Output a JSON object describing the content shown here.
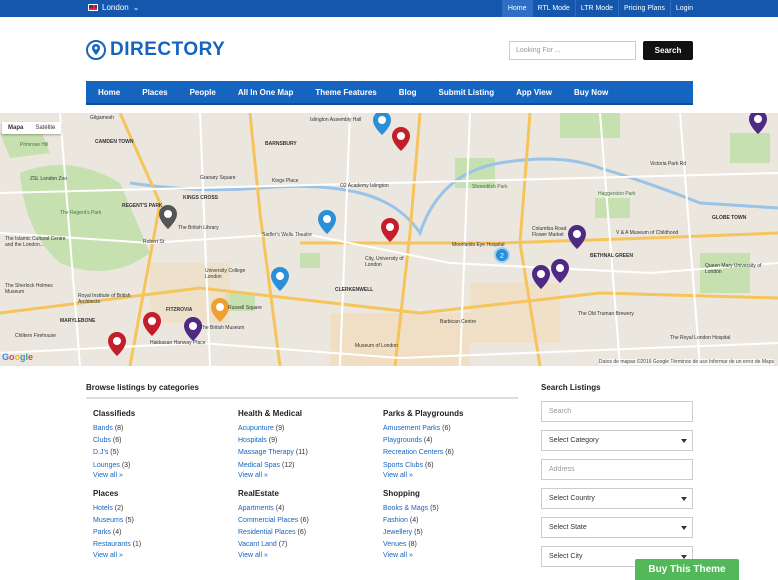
{
  "topbar": {
    "language": "London",
    "links": [
      "Home",
      "RTL Mode",
      "LTR Mode",
      "Pricing Plans",
      "Login"
    ],
    "active_link": "Home"
  },
  "header": {
    "logo_text": "DIRECTORY",
    "search_placeholder": "Looking For ...",
    "search_button": "Search"
  },
  "nav": {
    "items": [
      "Home",
      "Places",
      "People",
      "All In One Map",
      "Theme Features",
      "Blog",
      "Submit Listing",
      "App View",
      "Buy Now"
    ]
  },
  "map": {
    "type_map": "Mapa",
    "type_satellite": "Satélite",
    "google": "Google",
    "attribution": "Datos de mapas ©2016 Google   Términos de uso   Informar de un error de Maps",
    "labels": [
      {
        "text": "Gilgamesh",
        "cls": "l1"
      },
      {
        "text": "CAMDEN TOWN",
        "cls": "l2"
      },
      {
        "text": "Primrose Hill",
        "cls": "l3"
      },
      {
        "text": "ZSL London Zoo",
        "cls": "l4"
      },
      {
        "text": "The Regent's Park",
        "cls": "l5"
      },
      {
        "text": "REGENT'S PARK",
        "cls": "l6"
      },
      {
        "text": "The Islamic Cultural Centre and the London...",
        "cls": "l7"
      },
      {
        "text": "The Sherlock Holmes Museum",
        "cls": "l8"
      },
      {
        "text": "MARYLEBONE",
        "cls": "l9"
      },
      {
        "text": "Chiltern Firehouse",
        "cls": "l10"
      },
      {
        "text": "FITZROVIA",
        "cls": "l11"
      },
      {
        "text": "Royal Institute of British Architects",
        "cls": "l12"
      },
      {
        "text": "The British Library",
        "cls": "l13"
      },
      {
        "text": "KINGS CROSS",
        "cls": "l14"
      },
      {
        "text": "Granary Square",
        "cls": "l15"
      },
      {
        "text": "BARNSBURY",
        "cls": "l16"
      },
      {
        "text": "Kings Place",
        "cls": "l17"
      },
      {
        "text": "Islington Assembly Hall",
        "cls": "l18"
      },
      {
        "text": "O2 Academy Islington",
        "cls": "l19"
      },
      {
        "text": "Sadler's Wells Theatre",
        "cls": "l20"
      },
      {
        "text": "University College London",
        "cls": "l21"
      },
      {
        "text": "Russell Square",
        "cls": "l22"
      },
      {
        "text": "The British Museum",
        "cls": "l23"
      },
      {
        "text": "Hakkasan Hanway Place",
        "cls": "l24"
      },
      {
        "text": "CLERKENWELL",
        "cls": "l25"
      },
      {
        "text": "City, University of London",
        "cls": "l26"
      },
      {
        "text": "Moorfields Eye Hospital",
        "cls": "l27"
      },
      {
        "text": "Barbican Centre",
        "cls": "l28"
      },
      {
        "text": "Museum of London",
        "cls": "l29"
      },
      {
        "text": "Shoreditch Park",
        "cls": "l30"
      },
      {
        "text": "Haggerston Park",
        "cls": "l31"
      },
      {
        "text": "Columbia Road Flower Market",
        "cls": "l32"
      },
      {
        "text": "V & A Museum of Childhood",
        "cls": "l33"
      },
      {
        "text": "BETHNAL GREEN",
        "cls": "l34"
      },
      {
        "text": "GLOBE TOWN",
        "cls": "l35"
      },
      {
        "text": "The Old Truman Brewery",
        "cls": "l36"
      },
      {
        "text": "The Royal London Hospital",
        "cls": "l37"
      },
      {
        "text": "Victoria Park Rd",
        "cls": "l38"
      },
      {
        "text": "Queen Mary University of London",
        "cls": "l39"
      },
      {
        "text": "Robert St",
        "cls": "l40"
      }
    ]
  },
  "categories": {
    "title": "Browse listings by categories",
    "groups": [
      {
        "name": "Classifieds",
        "items": [
          {
            "label": "Bands",
            "count": "(8)"
          },
          {
            "label": "Clubs",
            "count": "(6)"
          },
          {
            "label": "D.J's",
            "count": "(5)"
          },
          {
            "label": "Lounges",
            "count": "(3)"
          }
        ],
        "view_all": "View all »"
      },
      {
        "name": "Health & Medical",
        "items": [
          {
            "label": "Acupunture",
            "count": "(9)"
          },
          {
            "label": "Hospitals",
            "count": "(9)"
          },
          {
            "label": "Massage Therapy",
            "count": "(11)"
          },
          {
            "label": "Medical Spas",
            "count": "(12)"
          }
        ],
        "view_all": "View all »"
      },
      {
        "name": "Parks & Playgrounds",
        "items": [
          {
            "label": "Amusement Parks",
            "count": "(6)"
          },
          {
            "label": "Playgrounds",
            "count": "(4)"
          },
          {
            "label": "Recreation Centers",
            "count": "(6)"
          },
          {
            "label": "Sports Clubs",
            "count": "(6)"
          }
        ],
        "view_all": "View all »"
      },
      {
        "name": "Places",
        "items": [
          {
            "label": "Hotels",
            "count": "(2)"
          },
          {
            "label": "Museums",
            "count": "(5)"
          },
          {
            "label": "Parks",
            "count": "(4)"
          },
          {
            "label": "Restaurants",
            "count": "(1)"
          }
        ],
        "view_all": "View all »"
      },
      {
        "name": "RealEstate",
        "items": [
          {
            "label": "Apartments",
            "count": "(4)"
          },
          {
            "label": "Commercial Places",
            "count": "(6)"
          },
          {
            "label": "Residential Places",
            "count": "(6)"
          },
          {
            "label": "Vacant Land",
            "count": "(7)"
          }
        ],
        "view_all": "View all »"
      },
      {
        "name": "Shopping",
        "items": [
          {
            "label": "Books & Mags",
            "count": "(5)"
          },
          {
            "label": "Fashion",
            "count": "(4)"
          },
          {
            "label": "Jewellery",
            "count": "(5)"
          },
          {
            "label": "Venues",
            "count": "(8)"
          }
        ],
        "view_all": "View all »"
      }
    ]
  },
  "search_listings": {
    "title": "Search Listings",
    "search_placeholder": "Search",
    "category": "Select Category",
    "address_placeholder": "Address",
    "country": "Select Country",
    "state": "Select State",
    "city": "Select City"
  },
  "buy_button": "Buy This Theme",
  "cluster_count": "2",
  "colors": {
    "primary": "#1565c0",
    "topbar": "#1557ad",
    "buy": "#52b85a",
    "marker_red": "#c41e2a",
    "marker_purple": "#4e2a84",
    "marker_blue": "#2a8fd6",
    "marker_orange": "#f0a030",
    "marker_gray": "#555555"
  }
}
